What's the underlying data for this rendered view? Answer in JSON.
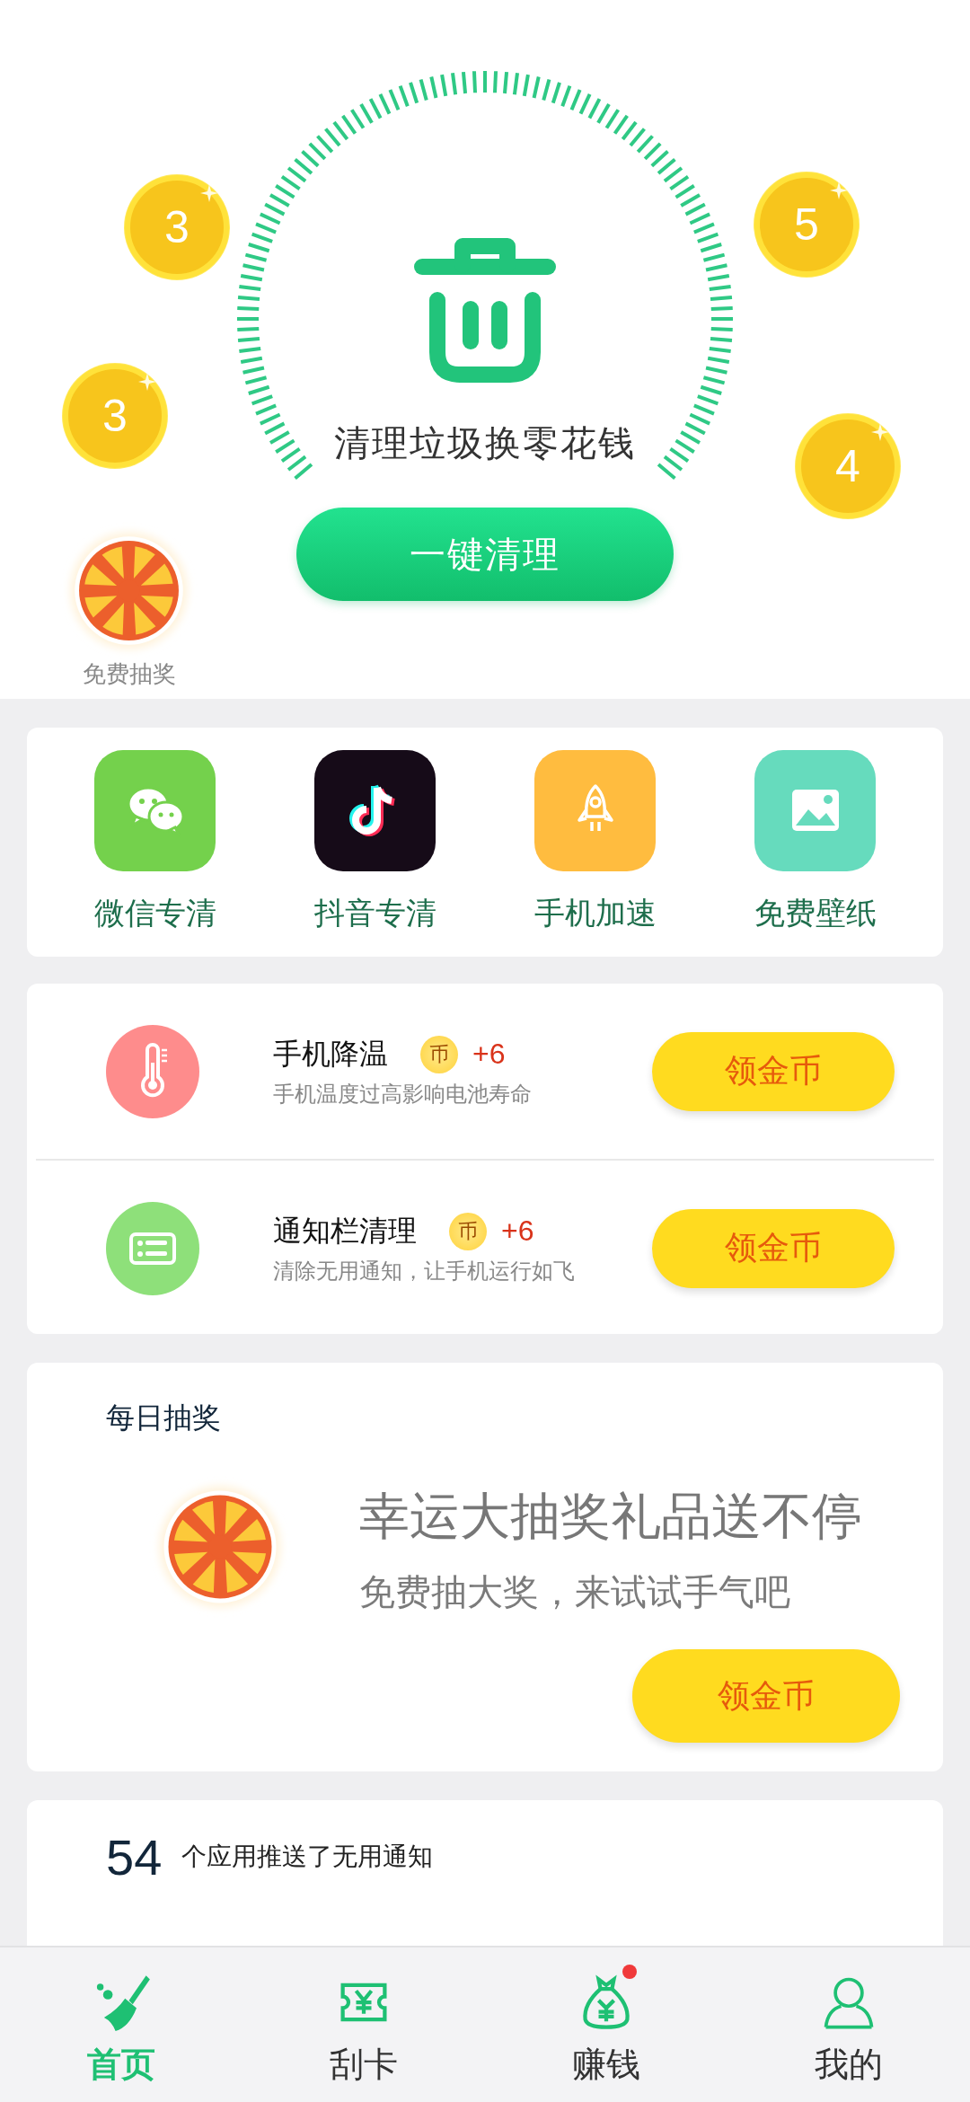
{
  "hero": {
    "coins": [
      {
        "value": "3"
      },
      {
        "value": "3"
      },
      {
        "value": "5"
      },
      {
        "value": "4"
      }
    ],
    "heading": "清理垃圾换零花钱",
    "clean_button": "一键清理",
    "lottery_label": "免费抽奖"
  },
  "shortcuts": [
    {
      "kind": "wechat",
      "label": "微信专清",
      "color": "#74d14c"
    },
    {
      "kind": "douyin",
      "label": "抖音专清",
      "color": "#160b18"
    },
    {
      "kind": "rocket",
      "label": "手机加速",
      "color": "#ffbc3f"
    },
    {
      "kind": "wallpaper",
      "label": "免费壁纸",
      "color": "#66dbbd"
    }
  ],
  "tasks": [
    {
      "kind": "thermometer",
      "title": "手机降温",
      "coin_symbol": "币",
      "reward": "+6",
      "subtitle": "手机温度过高影响电池寿命",
      "button": "领金币"
    },
    {
      "kind": "notification",
      "title": "通知栏清理",
      "coin_symbol": "币",
      "reward": "+6",
      "subtitle": "清除无用通知，让手机运行如飞",
      "button": "领金币"
    }
  ],
  "daily_lottery": {
    "heading": "每日抽奖",
    "title": "幸运大抽奖礼品送不停",
    "subtitle": "免费抽大奖，来试试手气吧",
    "button": "领金币"
  },
  "notice": {
    "count": "54",
    "text": "个应用推送了无用通知"
  },
  "bottom_nav": [
    {
      "kind": "broom",
      "label": "首页",
      "selected": true,
      "badge": false
    },
    {
      "kind": "ticket",
      "label": "刮卡",
      "selected": false,
      "badge": false
    },
    {
      "kind": "moneybag",
      "label": "赚钱",
      "selected": false,
      "badge": true
    },
    {
      "kind": "person",
      "label": "我的",
      "selected": false,
      "badge": false
    }
  ]
}
